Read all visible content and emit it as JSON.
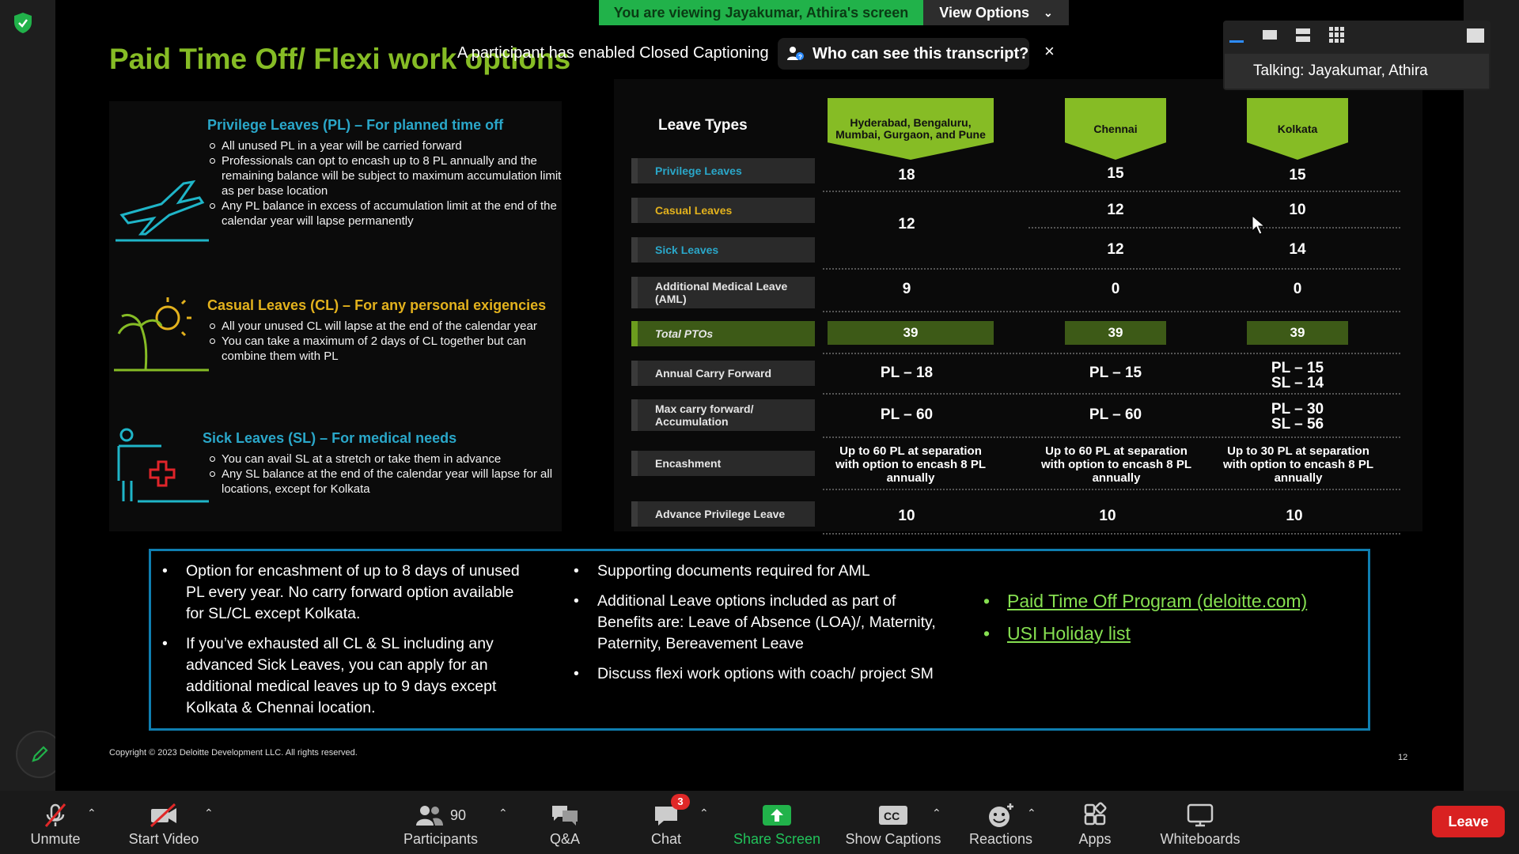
{
  "banner": {
    "viewing": "You are viewing Jayakumar, Athira's screen",
    "view_options": "View Options"
  },
  "captions_notice": {
    "message": "A participant has enabled Closed Captioning",
    "button": "Who can see this transcript?",
    "close": "×"
  },
  "speaker_panel": {
    "talking": "Talking: Jayakumar, Athira"
  },
  "slide": {
    "title": "Paid Time Off/ Flexi work options",
    "leave_sections": [
      {
        "heading": "Privilege Leaves (PL) – For planned time off",
        "color": "#2aa7c9",
        "bullets": [
          "All unused PL in a year will be carried forward",
          "Professionals can opt to encash up to 8 PL annually and the remaining balance will be subject to maximum accumulation limit as per base location",
          "Any PL balance in excess of accumulation limit at the end of the calendar year will lapse permanently"
        ]
      },
      {
        "heading": "Casual Leaves (CL) – For any personal exigencies",
        "color": "#e3b21d",
        "bullets": [
          "All your unused CL will lapse at the end of the calendar year",
          "You can take a maximum of 2 days of CL together but can combine them with PL"
        ]
      },
      {
        "heading": "Sick Leaves (SL) – For medical needs",
        "color": "#2aa7c9",
        "bullets": [
          "You can avail SL at a stretch or take them in advance",
          "Any SL balance at the end of the calendar year will lapse for all locations, except for Kolkata"
        ]
      }
    ],
    "table": {
      "title": "Leave Types",
      "locations": [
        "Hyderabad, Bengaluru, Mumbai, Gurgaon, and Pune",
        "Chennai",
        "Kolkata"
      ],
      "rows": [
        {
          "label": "Privilege Leaves",
          "values": [
            "18",
            "15",
            "15"
          ]
        },
        {
          "label": "Casual Leaves",
          "values": [
            "12",
            "12",
            "10"
          ]
        },
        {
          "label": "Sick Leaves",
          "values": [
            "",
            "12",
            "14"
          ]
        },
        {
          "label": "Additional Medical Leave (AML)",
          "values": [
            "9",
            "0",
            "0"
          ]
        },
        {
          "label": "Total PTOs",
          "values": [
            "39",
            "39",
            "39"
          ]
        },
        {
          "label": "Annual Carry Forward",
          "values": [
            "PL – 18",
            "PL – 15",
            "PL – 15\nSL – 14"
          ]
        },
        {
          "label": "Max carry forward/ Accumulation",
          "values": [
            "PL – 60",
            "PL – 60",
            "PL – 30\nSL – 56"
          ]
        },
        {
          "label": "Encashment",
          "values": [
            "Up to 60 PL at separation with option to encash 8 PL annually",
            "Up to 60 PL at separation with option to encash 8 PL annually",
            "Up to 30 PL at separation with option to encash 8 PL annually"
          ]
        },
        {
          "label": "Advance Privilege Leave",
          "values": [
            "10",
            "10",
            "10"
          ]
        }
      ]
    },
    "notes": {
      "col1": [
        "Option for encashment of up to 8 days of unused PL every year. No carry forward option available for SL/CL except Kolkata.",
        "If you’ve exhausted all CL & SL including any advanced Sick Leaves, you can apply for an additional medical leaves up to 9 days except Kolkata  & Chennai location."
      ],
      "col2": [
        "Supporting documents required for AML",
        "Additional Leave options included as part of Benefits are: Leave of Absence (LOA)/, Maternity, Paternity, Bereavement Leave",
        "Discuss flexi work options with coach/ project SM"
      ],
      "links": [
        "Paid Time Off Program (deloitte.com)",
        "USI Holiday list"
      ]
    },
    "copyright": "Copyright © 2023 Deloitte Development LLC. All rights reserved.",
    "page_number": "12"
  },
  "toolbar": {
    "unmute": "Unmute",
    "start_video": "Start Video",
    "participants": "Participants",
    "participants_count": "90",
    "qa": "Q&A",
    "chat": "Chat",
    "chat_badge": "3",
    "share_screen": "Share Screen",
    "show_captions": "Show Captions",
    "reactions": "Reactions",
    "apps": "Apps",
    "whiteboards": "Whiteboards",
    "leave": "Leave"
  },
  "colors": {
    "deloitte_green": "#86bc25",
    "zoom_green": "#21b24a",
    "leave_red": "#d92121",
    "note_border": "#0f7eb0"
  }
}
